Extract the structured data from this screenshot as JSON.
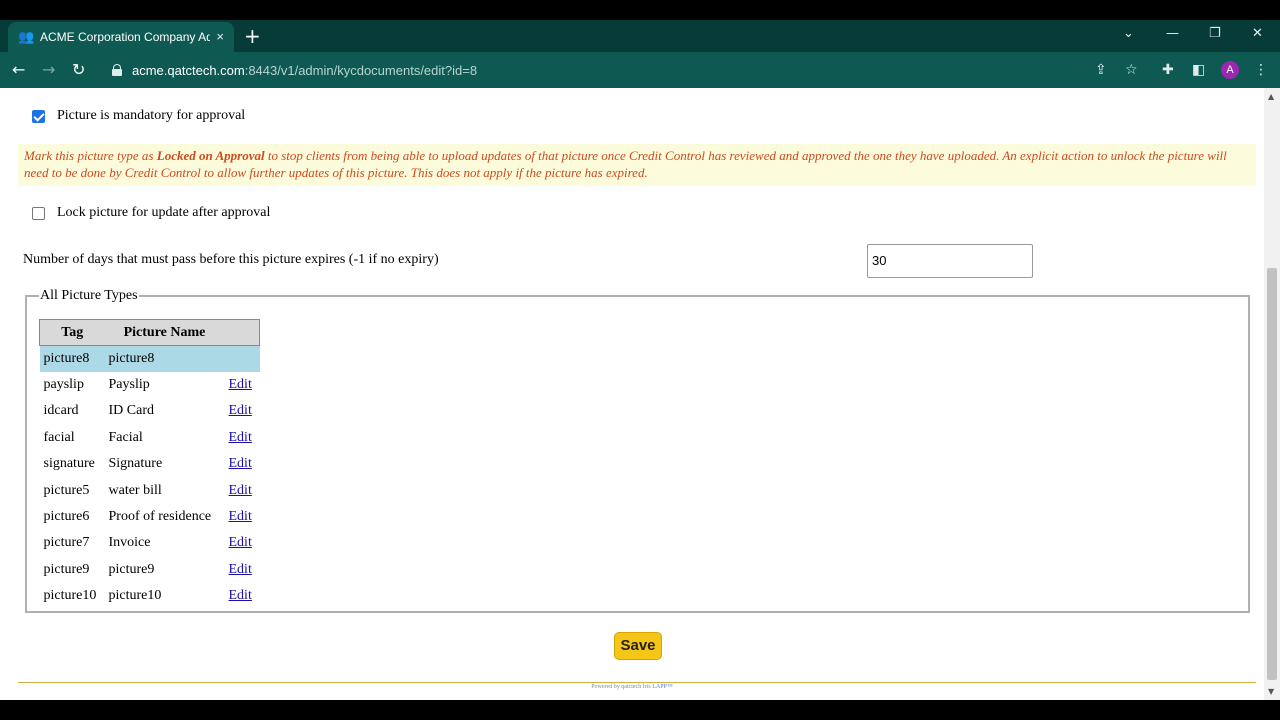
{
  "browser": {
    "tab_title": "ACME Corporation Company Adr",
    "tab_close": "×",
    "new_tab": "+",
    "url_host": "acme.qatctech.com",
    "url_rest": ":8443/v1/admin/kycdocuments/edit?id=8",
    "profile_initial": "A",
    "icons": [
      "back-icon",
      "forward-icon",
      "reload-icon",
      "lock-icon",
      "share-icon",
      "star-icon",
      "extensions-icon",
      "sidepanel-icon",
      "menu-icon"
    ]
  },
  "form": {
    "mandatory_label": "Picture is mandatory for approval",
    "mandatory_checked": true,
    "notice_prefix": "Mark this picture type as ",
    "notice_bold": "Locked on Approval",
    "notice_suffix": " to stop clients from being able to upload updates of that picture once Credit Control has reviewed and approved the one they have uploaded. An explicit action to unlock the picture will need to be done by Credit Control to allow further updates of this picture. This does not apply if the picture has expired.",
    "lock_label": "Lock picture for update after approval",
    "lock_checked": false,
    "days_label": "Number of days that must pass before this picture expires (-1 if no expiry)",
    "days_value": "30"
  },
  "picture_types": {
    "legend": "All Picture Types",
    "headers": [
      "Tag",
      "Picture Name"
    ],
    "edit_label": "Edit",
    "rows": [
      {
        "tag": "picture8",
        "name": "picture8",
        "selected": true
      },
      {
        "tag": "payslip",
        "name": "Payslip",
        "selected": false
      },
      {
        "tag": "idcard",
        "name": "ID Card",
        "selected": false
      },
      {
        "tag": "facial",
        "name": "Facial",
        "selected": false
      },
      {
        "tag": "signature",
        "name": "Signature",
        "selected": false
      },
      {
        "tag": "picture5",
        "name": "water bill",
        "selected": false
      },
      {
        "tag": "picture6",
        "name": "Proof of residence",
        "selected": false
      },
      {
        "tag": "picture7",
        "name": "Invoice",
        "selected": false
      },
      {
        "tag": "picture9",
        "name": "picture9",
        "selected": false
      },
      {
        "tag": "picture10",
        "name": "picture10",
        "selected": false
      }
    ]
  },
  "actions": {
    "save_label": "Save"
  },
  "footer": {
    "powered_by": "Powered by qatctech Iris ",
    "brand": "LAPP™"
  },
  "colors": {
    "chrome": "#0e5a53",
    "notice_text": "#cc4a1e",
    "notice_bg": "#fcfcdc",
    "selected_row": "#add8e6",
    "save_button": "#f5c518"
  }
}
